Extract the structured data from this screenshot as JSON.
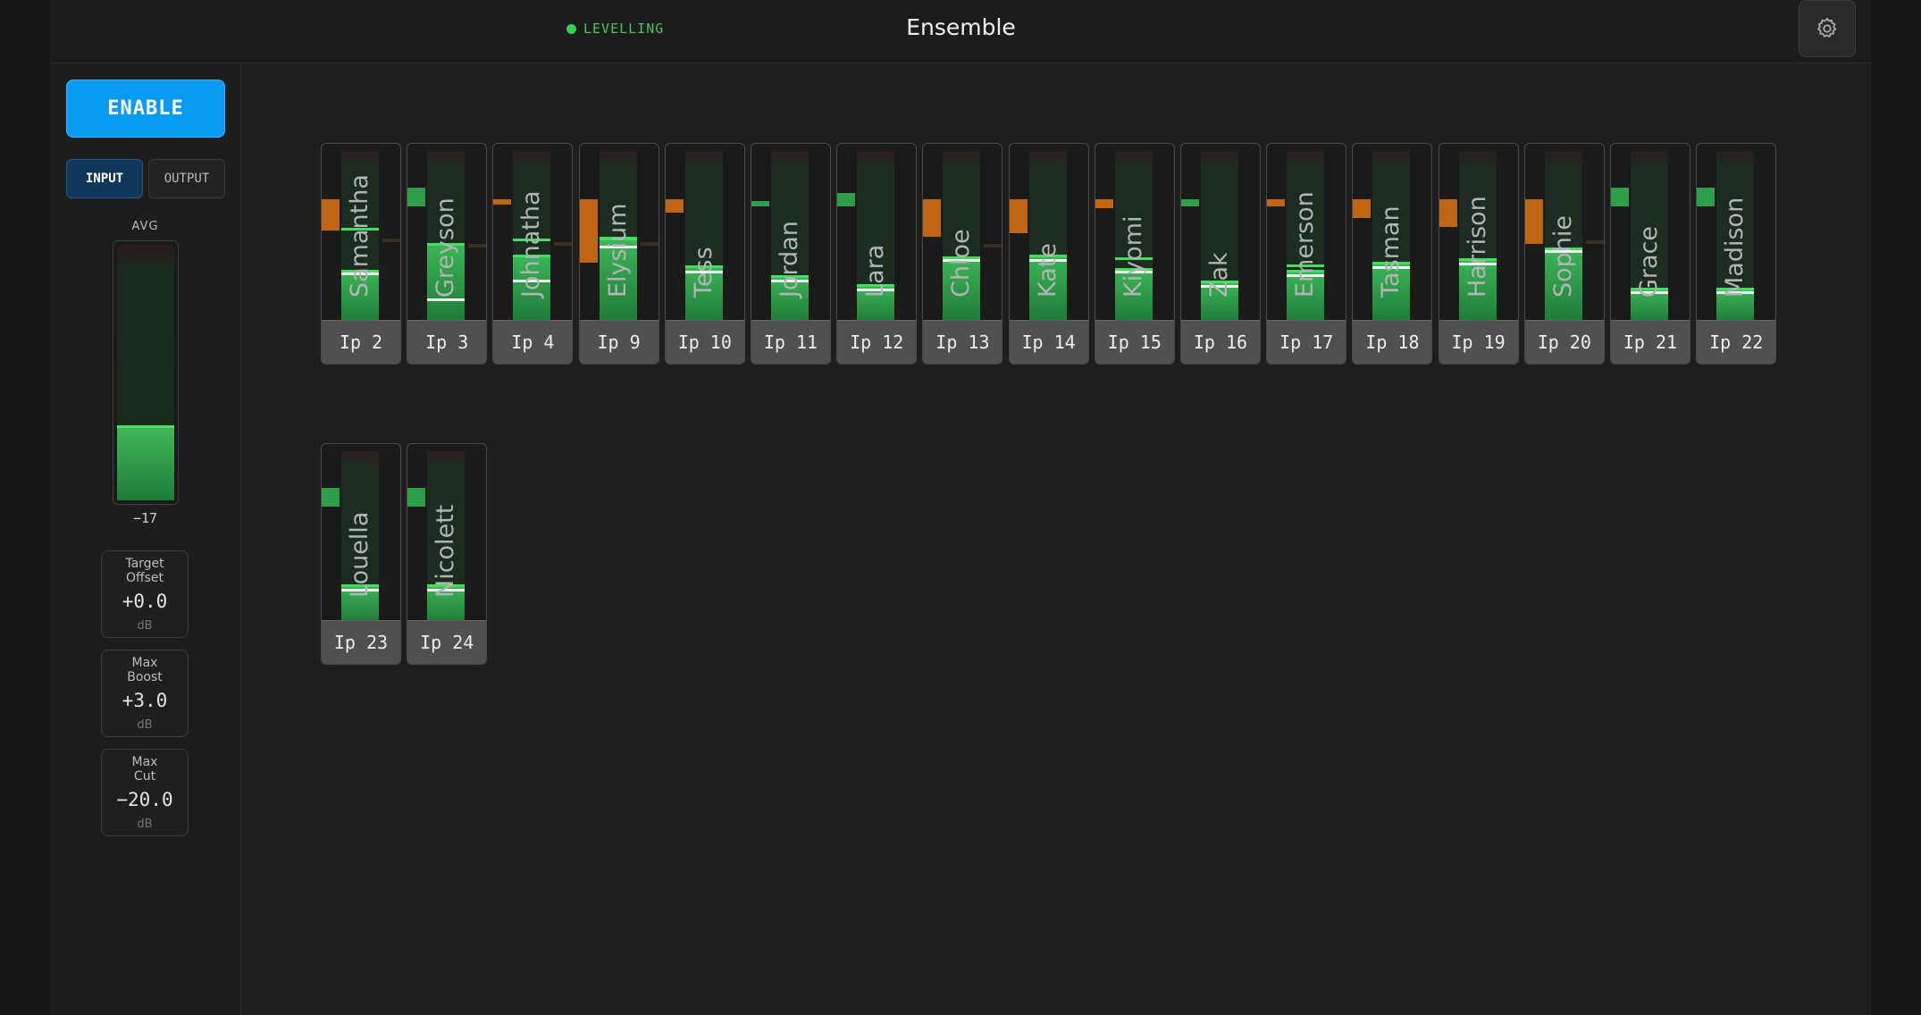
{
  "header": {
    "status": "LEVELLING",
    "status_color": "#35d04d",
    "title": "Ensemble",
    "settings_icon": "gear-icon"
  },
  "sidebar": {
    "enable_label": "ENABLE",
    "input_label": "INPUT",
    "output_label": "OUTPUT",
    "avg_label": "AVG",
    "avg_value": "−17",
    "avg_level": 0.28,
    "params": [
      {
        "label": "Target\nOffset",
        "value": "+0.0",
        "unit": "dB"
      },
      {
        "label": "Max\nBoost",
        "value": "+3.0",
        "unit": "dB"
      },
      {
        "label": "Max\nCut",
        "value": "−20.0",
        "unit": "dB"
      }
    ]
  },
  "channels": [
    {
      "name": "Samantha",
      "label": "Ip 2",
      "level": 0.3,
      "white": 0.29,
      "green": 0.55,
      "gain_type": "cut",
      "gain": 0.18,
      "tick": 0.49
    },
    {
      "name": "Greyson",
      "label": "Ip 3",
      "level": 0.46,
      "white": 0.14,
      "green": 0.46,
      "gain_type": "boost",
      "gain": 0.11,
      "tick": 0.46
    },
    {
      "name": "Johnatha",
      "label": "Ip 4",
      "level": 0.39,
      "white": 0.25,
      "green": 0.49,
      "gain_type": "cut",
      "gain": 0.03,
      "tick": 0.47
    },
    {
      "name": "Elysium",
      "label": "Ip 9",
      "level": 0.49,
      "white": 0.45,
      "green": 0.5,
      "gain_type": "cut",
      "gain": 0.37,
      "tick": 0.47
    },
    {
      "name": "Tess",
      "label": "Ip 10",
      "level": 0.33,
      "white": 0.3,
      "green": 0.33,
      "gain_type": "cut",
      "gain": 0.08,
      "tick": 0
    },
    {
      "name": "Jordan",
      "label": "Ip 11",
      "level": 0.27,
      "white": 0.25,
      "green": 0.27,
      "gain_type": "boost",
      "gain": 0.03,
      "tick": 0
    },
    {
      "name": "Lara",
      "label": "Ip 12",
      "level": 0.22,
      "white": 0.2,
      "green": 0.22,
      "gain_type": "boost",
      "gain": 0.08,
      "tick": 0
    },
    {
      "name": "Chloe",
      "label": "Ip 13",
      "level": 0.38,
      "white": 0.37,
      "green": 0.38,
      "gain_type": "cut",
      "gain": 0.22,
      "tick": 0.46
    },
    {
      "name": "Kate",
      "label": "Ip 14",
      "level": 0.39,
      "white": 0.37,
      "green": 0.39,
      "gain_type": "cut",
      "gain": 0.2,
      "tick": 0
    },
    {
      "name": "Kiyomi",
      "label": "Ip 15",
      "level": 0.31,
      "white": 0.3,
      "green": 0.38,
      "gain_type": "cut",
      "gain": 0.05,
      "tick": 0
    },
    {
      "name": "Zak",
      "label": "Ip 16",
      "level": 0.24,
      "white": 0.22,
      "green": 0.24,
      "gain_type": "boost",
      "gain": 0.04,
      "tick": 0
    },
    {
      "name": "Emerson",
      "label": "Ip 17",
      "level": 0.3,
      "white": 0.28,
      "green": 0.34,
      "gain_type": "cut",
      "gain": 0.04,
      "tick": 0
    },
    {
      "name": "Tasman",
      "label": "Ip 18",
      "level": 0.35,
      "white": 0.33,
      "green": 0.35,
      "gain_type": "cut",
      "gain": 0.11,
      "tick": 0
    },
    {
      "name": "Harrison",
      "label": "Ip 19",
      "level": 0.37,
      "white": 0.35,
      "green": 0.37,
      "gain_type": "cut",
      "gain": 0.16,
      "tick": 0
    },
    {
      "name": "Sophie",
      "label": "Ip 20",
      "level": 0.43,
      "white": 0.42,
      "green": 0.43,
      "gain_type": "cut",
      "gain": 0.26,
      "tick": 0.48
    },
    {
      "name": "Grace",
      "label": "Ip 21",
      "level": 0.2,
      "white": 0.18,
      "green": 0.2,
      "gain_type": "boost",
      "gain": 0.11,
      "tick": 0
    },
    {
      "name": "Madison",
      "label": "Ip 22",
      "level": 0.2,
      "white": 0.18,
      "green": 0.2,
      "gain_type": "boost",
      "gain": 0.11,
      "tick": 0
    },
    {
      "name": "Louella",
      "label": "Ip 23",
      "level": 0.22,
      "white": 0.2,
      "green": 0.22,
      "gain_type": "boost",
      "gain": 0.11,
      "tick": 0
    },
    {
      "name": "Nicolett",
      "label": "Ip 24",
      "level": 0.22,
      "white": 0.2,
      "green": 0.22,
      "gain_type": "boost",
      "gain": 0.11,
      "tick": 0
    }
  ]
}
